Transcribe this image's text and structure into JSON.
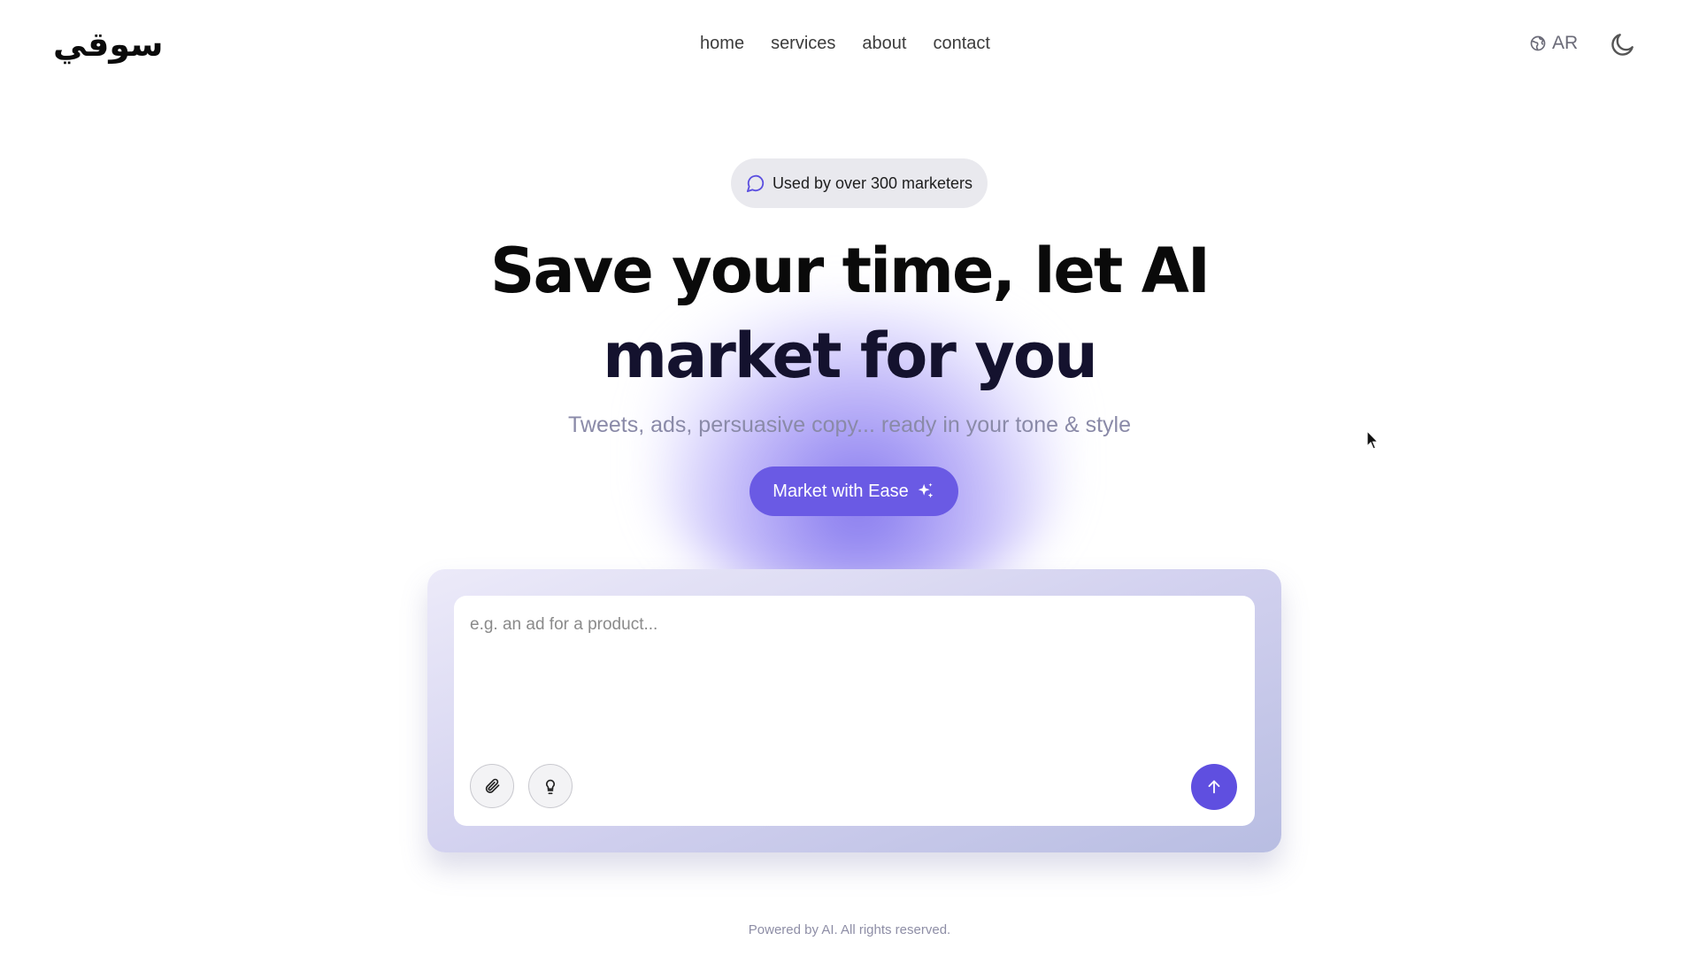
{
  "header": {
    "logo": "سوقي",
    "nav": [
      "home",
      "services",
      "about",
      "contact"
    ],
    "language": "AR",
    "language_icon": "globe-icon",
    "theme_icon": "moon-icon"
  },
  "hero": {
    "badge_icon": "chat-bubble-icon",
    "badge_text": "Used by over 300 marketers",
    "headline_line1": "Save your time, let AI",
    "headline_line2": "market for you",
    "subtitle": "Tweets, ads, persuasive copy... ready in your tone & style",
    "cta_label": "Market with Ease",
    "cta_icon": "sparkles-icon"
  },
  "composer": {
    "placeholder": "e.g. an ad for a product...",
    "value": "",
    "attach_icon": "paperclip-icon",
    "idea_icon": "lightbulb-icon",
    "send_icon": "arrow-up-icon"
  },
  "footer": {
    "text": "Powered by AI. All rights reserved."
  },
  "colors": {
    "accent": "#6a5ae4",
    "send": "#5f4fe0",
    "badge_bg": "#e9e9ee",
    "subtitle": "#8a8aa8"
  }
}
